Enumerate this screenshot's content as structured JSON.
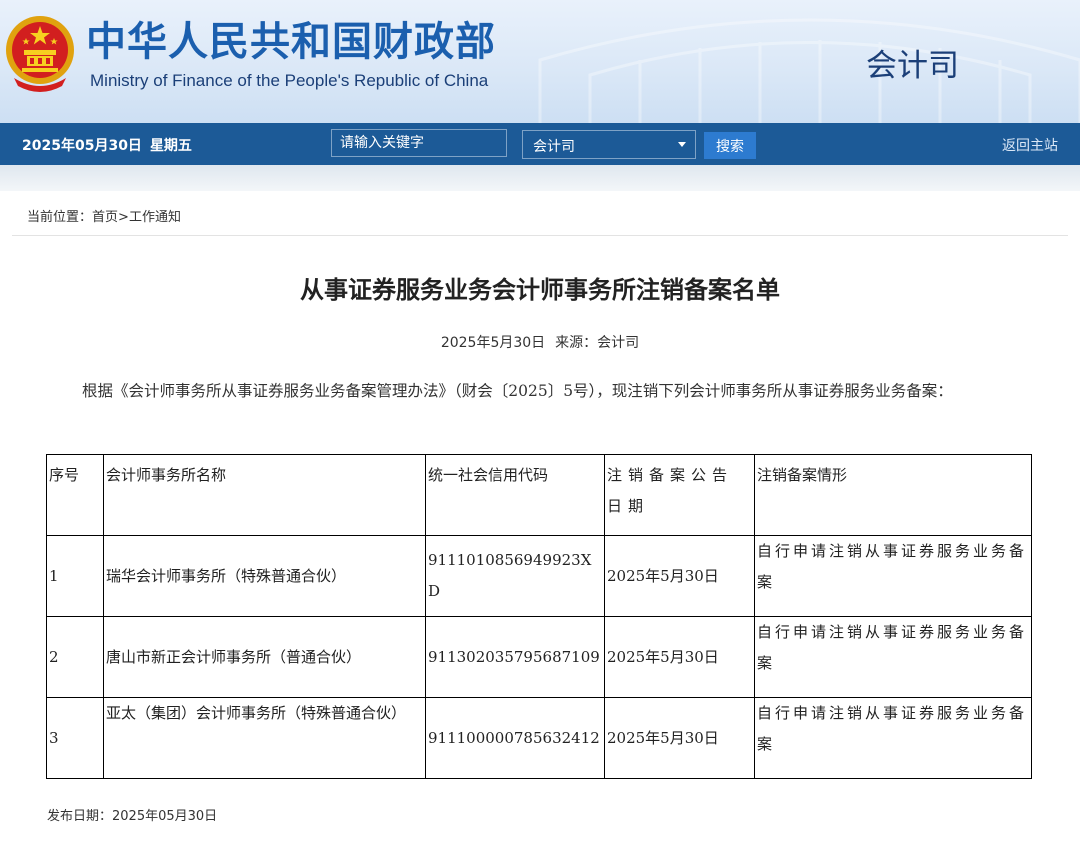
{
  "header": {
    "site_title_cn": "中华人民共和国财政部",
    "site_title_en": "Ministry of Finance of the People's Republic of China",
    "department": "会计司",
    "emblem_icon": "national-emblem-icon",
    "brand_color": "#1b5fae"
  },
  "navbar": {
    "date": "2025年05月30日",
    "weekday": "星期五",
    "search_placeholder": "请输入关键字",
    "scope_selected": "会计司",
    "search_button": "搜索",
    "home_link": "返回主站",
    "bar_color": "#1c5a97"
  },
  "breadcrumb": {
    "label": "当前位置：",
    "home": "首页",
    "separator": ">",
    "section": "工作通知"
  },
  "article": {
    "title": "从事证券服务业务会计师事务所注销备案名单",
    "date": "2025年5月30日",
    "source_label": "来源：",
    "source": "会计司",
    "intro": "根据《会计师事务所从事证券服务业务备案管理办法》（财会〔2025〕5号），现注销下列会计师事务所从事证券服务业务备案：",
    "table": {
      "headers": [
        "序号",
        "会计师事务所名称",
        "统一社会信用代码",
        "注销备案公告日期",
        "注销备案情形"
      ],
      "rows": [
        [
          "1",
          "瑞华会计师事务所（特殊普通合伙）",
          "9111010856949923XD",
          "2025年5月30日",
          "自行申请注销从事证券服务业务备案"
        ],
        [
          "2",
          "唐山市新正会计师事务所（普通合伙）",
          "911302035795687109",
          "2025年5月30日",
          "自行申请注销从事证券服务业务备案"
        ],
        [
          "3",
          "亚太（集团）会计师事务所（特殊普通合伙）",
          "911100000785632412",
          "2025年5月30日",
          "自行申请注销从事证券服务业务备案"
        ]
      ]
    },
    "publish_label": "发布日期：",
    "publish_date": "2025年05月30日"
  }
}
